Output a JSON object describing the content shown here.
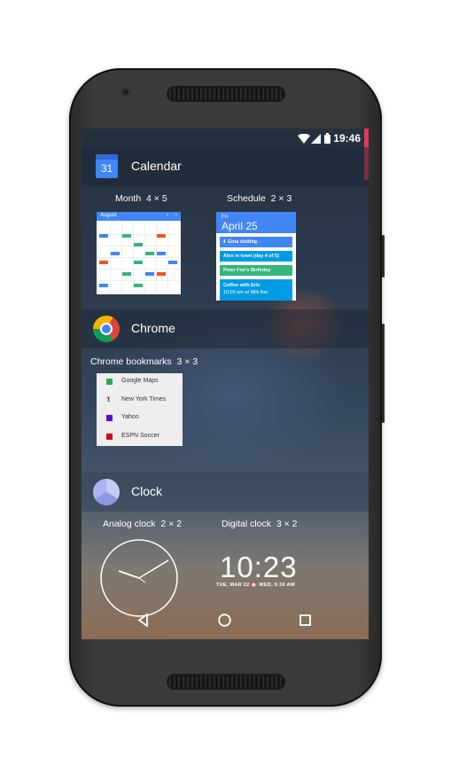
{
  "status_bar": {
    "time": "19:46"
  },
  "apps": [
    {
      "name": "Calendar",
      "icon_text": "31",
      "widgets": [
        {
          "label": "Month",
          "size": "4 × 5"
        },
        {
          "label": "Schedule",
          "size": "2 × 3"
        }
      ]
    },
    {
      "name": "Chrome",
      "widgets": [
        {
          "label": "Chrome bookmarks",
          "size": "3 × 3"
        }
      ]
    },
    {
      "name": "Clock",
      "widgets": [
        {
          "label": "Analog clock",
          "size": "2 × 2"
        },
        {
          "label": "Digital clock",
          "size": "3 × 2"
        }
      ]
    }
  ],
  "month_preview": {
    "month": "August",
    "prev": "‹",
    "next": "›"
  },
  "schedule_preview": {
    "day": "Fri",
    "date": "April 25",
    "events": [
      {
        "title": "Gina visiting",
        "color": "#4285f4"
      },
      {
        "title": "Alex in town (day 4 of 5)",
        "color": "#039be5"
      },
      {
        "title": "Peter Fox's Birthday",
        "color": "#33b679"
      },
      {
        "title": "Coffee with Eric",
        "detail": "10:00 am at Milk Bar",
        "color": "#039be5"
      }
    ]
  },
  "bookmarks": [
    {
      "title": "Google Maps",
      "color": "#34a853"
    },
    {
      "title": "New York Times",
      "color": "#222222"
    },
    {
      "title": "Yahoo",
      "color": "#5f01d1"
    },
    {
      "title": "ESPN Soccer",
      "color": "#d50a0a"
    }
  ],
  "digital_clock": {
    "time": "10:23",
    "date": "TUE, MAR 22 ⏰ WED, 6:30 AM"
  },
  "colors": {
    "accent": "#e8345c",
    "header": "#1e2837"
  }
}
